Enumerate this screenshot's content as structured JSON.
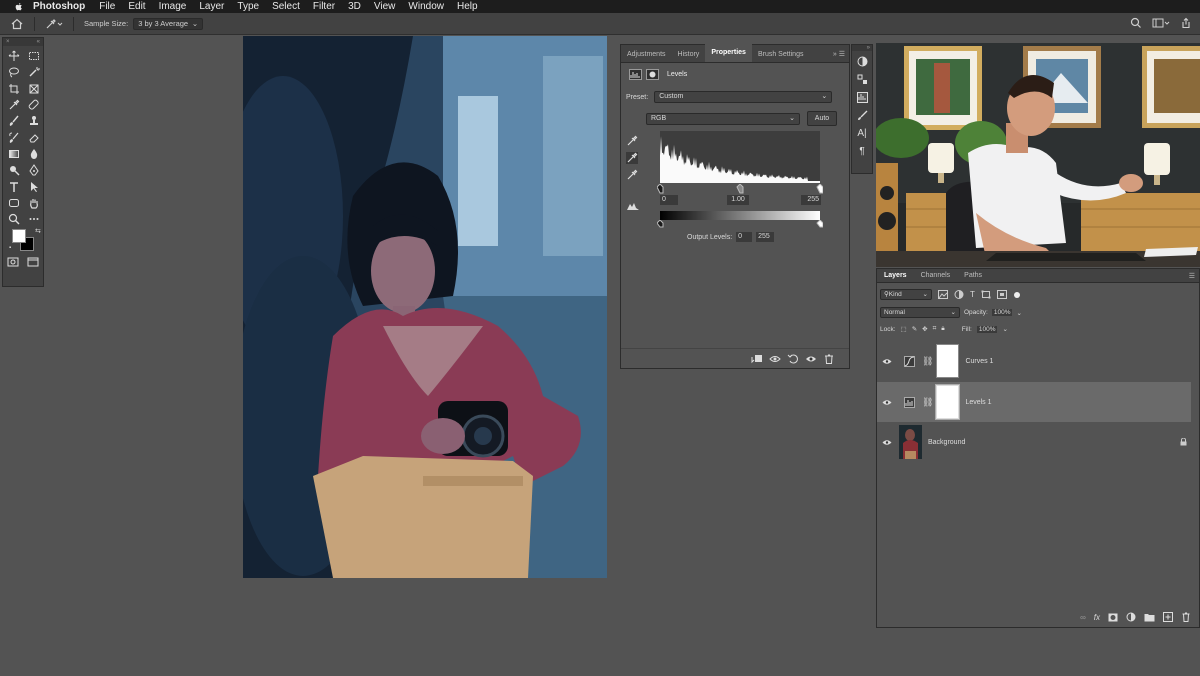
{
  "menubar": {
    "app": "Photoshop",
    "items": [
      "File",
      "Edit",
      "Image",
      "Layer",
      "Type",
      "Select",
      "Filter",
      "3D",
      "View",
      "Window",
      "Help"
    ]
  },
  "options": {
    "sample_size_label": "Sample Size:",
    "sample_size_value": "3 by 3 Average"
  },
  "properties": {
    "tabs": [
      "Adjustments",
      "History",
      "Properties",
      "Brush Settings"
    ],
    "active_tab": "Properties",
    "panel_title": "Levels",
    "preset_label": "Preset:",
    "preset_value": "Custom",
    "channel_value": "RGB",
    "auto_label": "Auto",
    "input_black": "0",
    "input_gamma": "1.00",
    "input_white": "255",
    "output_label": "Output Levels:",
    "output_black": "0",
    "output_white": "255"
  },
  "layers": {
    "tabs": [
      "Layers",
      "Channels",
      "Paths"
    ],
    "active_tab": "Layers",
    "kind_label": "Kind",
    "blend_mode": "Normal",
    "opacity_label": "Opacity:",
    "opacity_value": "100%",
    "lock_label": "Lock:",
    "fill_label": "Fill:",
    "fill_value": "100%",
    "items": [
      {
        "name": "Curves 1",
        "type": "curves"
      },
      {
        "name": "Levels 1",
        "type": "levels",
        "selected": true
      },
      {
        "name": "Background",
        "type": "image",
        "locked": true
      }
    ]
  },
  "colors": {
    "accent_selected_layer": "#6a6a6a",
    "panel_bg": "#535353",
    "panel_header": "#424242"
  }
}
